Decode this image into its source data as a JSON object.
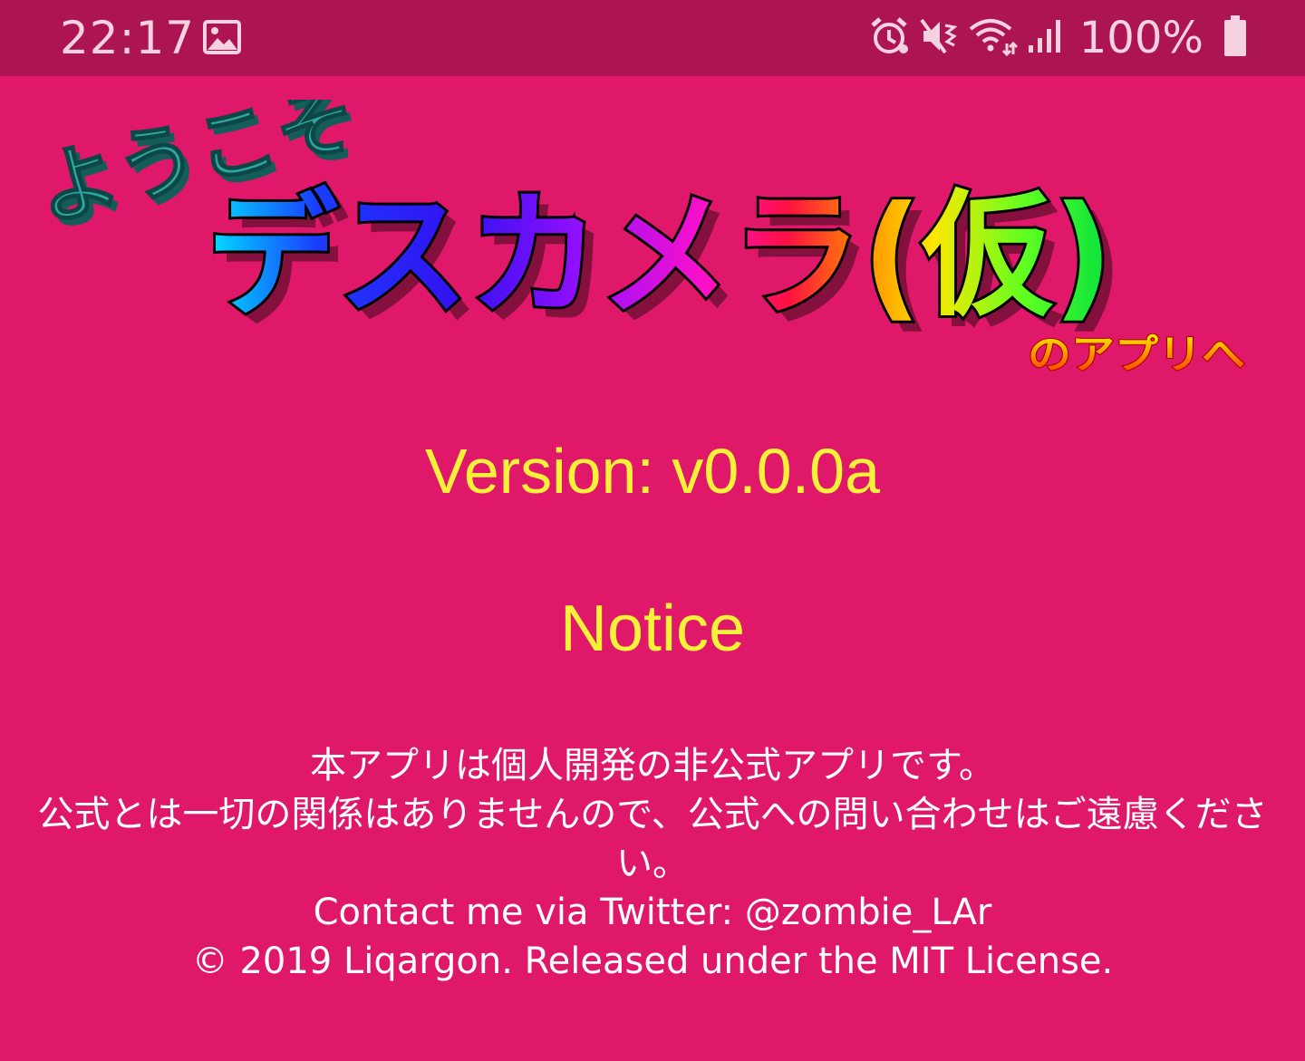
{
  "status_bar": {
    "time": "22:17",
    "battery_percent": "100%",
    "battery_level": 1.0,
    "icons": [
      "gallery-icon",
      "alarm-icon",
      "mute-icon",
      "wifi-icon",
      "signal-icon",
      "battery-icon"
    ]
  },
  "logo": {
    "welcome": "ようこそ",
    "app_name": "デスカメラ(仮)",
    "suffix": "のアプリへ"
  },
  "version": {
    "text": "Version: v0.0.0a"
  },
  "notice": {
    "title": "Notice",
    "line1": "本アプリは個人開発の非公式アプリです。",
    "line2": "公式とは一切の関係はありませんので、公式への問い合わせはご遠慮ください。",
    "contact": "Contact me via Twitter: @zombie_LAr",
    "copyright": "© 2019 Liqargon. Released under the MIT License."
  },
  "colors": {
    "background": "#e0186a",
    "status_bar": "#ad1552",
    "accent_yellow": "#f8f13a",
    "welcome_teal": "#2fa6a2"
  }
}
